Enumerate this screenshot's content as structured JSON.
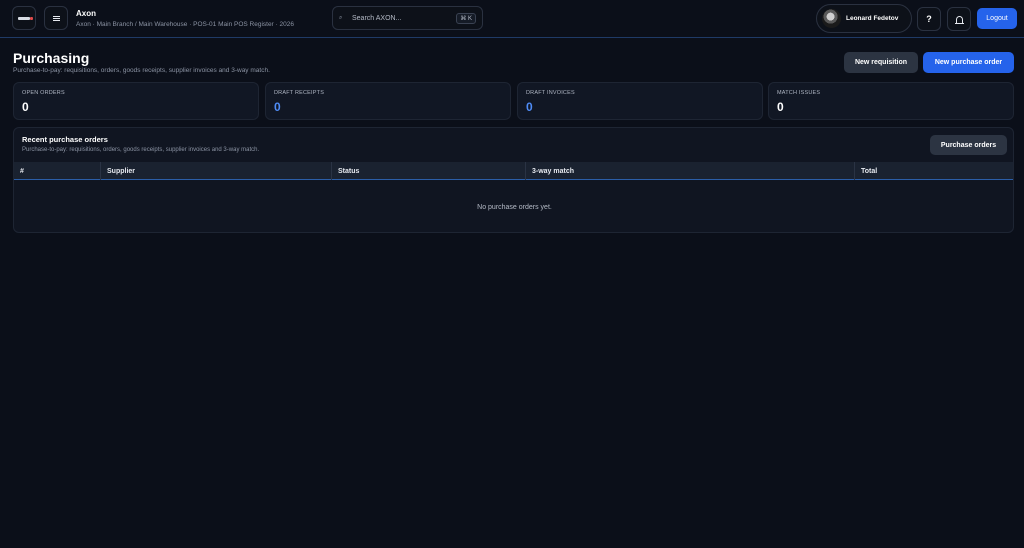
{
  "app": {
    "name": "Axon",
    "context": "Axon · Main Branch / Main Warehouse · POS-01 Main POS Register · 2026"
  },
  "search": {
    "placeholder": "Search AXON...",
    "shortcut": "⌘ K"
  },
  "user": {
    "name": "Leonard Fedetov"
  },
  "topbar": {
    "help_label": "?",
    "logout_label": "Logout"
  },
  "page": {
    "title": "Purchasing",
    "subtitle": "Purchase-to-pay: requisitions, orders, goods receipts, supplier invoices and 3-way match.",
    "new_requisition_label": "New requisition",
    "new_po_label": "New purchase order"
  },
  "stats": [
    {
      "label": "OPEN ORDERS",
      "value": "0"
    },
    {
      "label": "DRAFT RECEIPTS",
      "value": "0"
    },
    {
      "label": "DRAFT INVOICES",
      "value": "0"
    },
    {
      "label": "MATCH ISSUES",
      "value": "0"
    }
  ],
  "recent": {
    "title": "Recent purchase orders",
    "subtitle": "Purchase-to-pay: requisitions, orders, goods receipts, supplier invoices and 3-way match.",
    "button_label": "Purchase orders",
    "columns": [
      "#",
      "Supplier",
      "Status",
      "3-way match",
      "Total"
    ],
    "empty_text": "No purchase orders yet."
  },
  "colors": {
    "accent": "#2563eb",
    "background": "#0b0f19",
    "stat_value_blue": "#4f8cf7"
  },
  "icons": [
    "app-logo-icon",
    "menu-icon",
    "search-icon",
    "help-icon",
    "bell-icon"
  ]
}
